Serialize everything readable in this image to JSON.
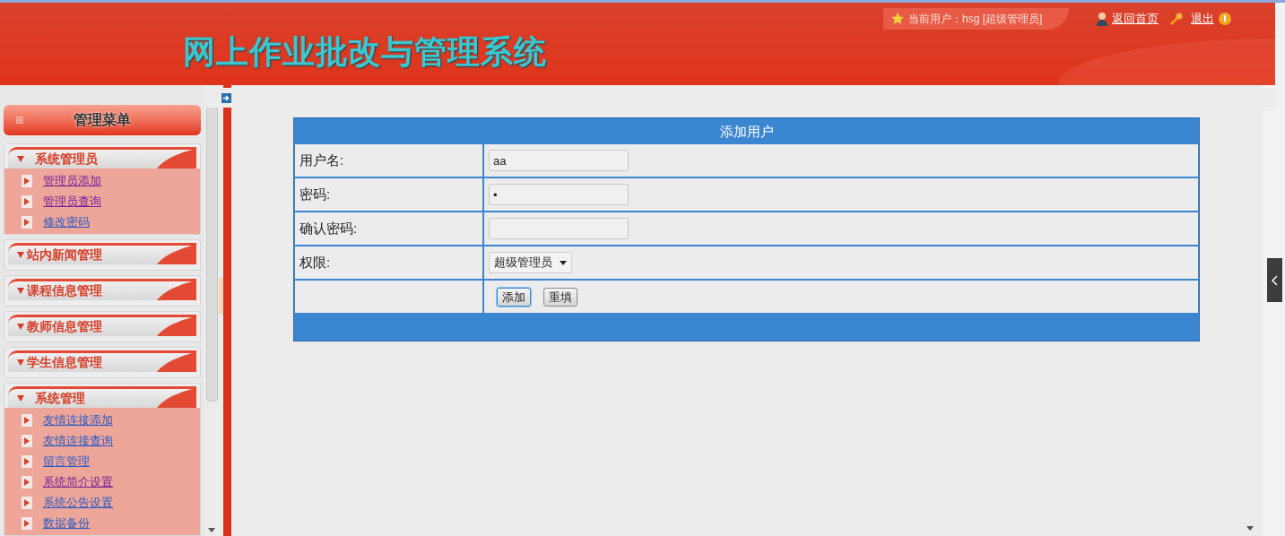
{
  "header": {
    "title": "网上作业批改与管理系统",
    "current_user": "当前用户：hsg [超级管理员]",
    "links": [
      {
        "label": "返回首页"
      },
      {
        "label": "退出"
      }
    ]
  },
  "sidebar": {
    "title": "管理菜单",
    "groups": [
      {
        "title": "系统管理员",
        "expanded": true,
        "items": [
          {
            "label": "管理员添加",
            "visited": true
          },
          {
            "label": "管理员查询",
            "visited": true
          },
          {
            "label": "修改密码",
            "visited": false
          }
        ]
      },
      {
        "title": "站内新闻管理",
        "expanded": false
      },
      {
        "title": "课程信息管理",
        "expanded": false
      },
      {
        "title": "教师信息管理",
        "expanded": false
      },
      {
        "title": "学生信息管理",
        "expanded": false
      },
      {
        "title": "系统管理",
        "expanded": true,
        "items": [
          {
            "label": "友情连接添加",
            "visited": false
          },
          {
            "label": "友情连接查询",
            "visited": false
          },
          {
            "label": "留言管理",
            "visited": false
          },
          {
            "label": "系统简介设置",
            "visited": true
          },
          {
            "label": "系统公告设置",
            "visited": false
          },
          {
            "label": "数据备份",
            "visited": false
          }
        ]
      }
    ]
  },
  "form": {
    "title": "添加用户",
    "fields": [
      {
        "kind": "text",
        "label": "用户名:",
        "value": "aa"
      },
      {
        "kind": "password",
        "label": "密码:",
        "value": "•"
      },
      {
        "kind": "password",
        "label": "确认密码:"
      },
      {
        "kind": "select",
        "label": "权限:",
        "value": "超级管理员"
      }
    ],
    "buttons": [
      {
        "label": "添加",
        "focused": true
      },
      {
        "label": "重填",
        "focused": false
      }
    ]
  }
}
